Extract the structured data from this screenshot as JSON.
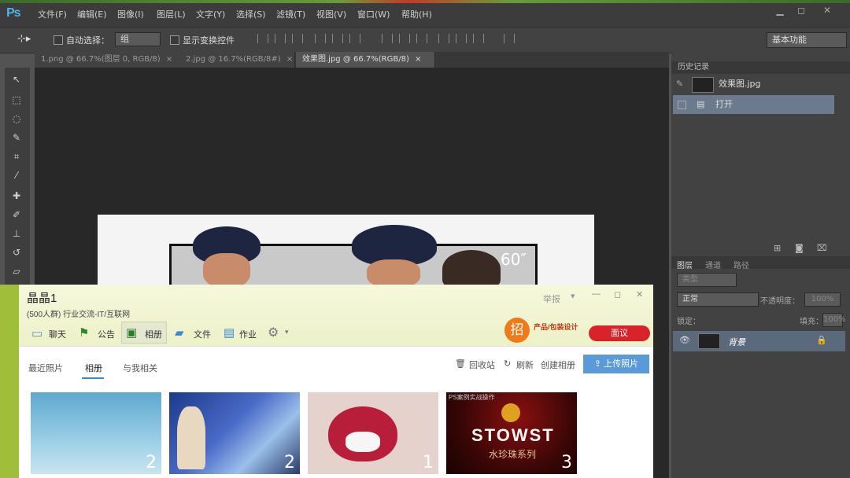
{
  "ps": {
    "logo": "Ps",
    "menu": [
      "文件(F)",
      "编辑(E)",
      "图像(I)",
      "图层(L)",
      "文字(Y)",
      "选择(S)",
      "滤镜(T)",
      "视图(V)",
      "窗口(W)",
      "帮助(H)"
    ],
    "window_controls": [
      "▁",
      "◻",
      "✕"
    ],
    "options": {
      "auto_select_label": "自动选择：",
      "auto_select_value": "组",
      "show_transform_label": "显示变换控件",
      "workspace": "基本功能"
    },
    "doc_tabs": [
      {
        "label": "1.png @ 66.7%(图层 0, RGB/8)"
      },
      {
        "label": "2.jpg @ 16.7%(RGB/8#)"
      },
      {
        "label": "效果图.jpg @ 66.7%(RGB/8)"
      }
    ],
    "tab_close": "×",
    "canvas_text": "60″",
    "history": {
      "title": "历史记录",
      "snapshot": "效果图.jpg",
      "step": "打开"
    },
    "layers": {
      "tabs": [
        "图层",
        "通道",
        "路径"
      ],
      "filter": "类型",
      "blend": "正常",
      "opacity_label": "不透明度：",
      "opacity_value": "100%",
      "lock_label": "锁定：",
      "fill_label": "填充：",
      "fill_value": "100%",
      "layer_name": "背景"
    }
  },
  "qq": {
    "title": "晶晶1",
    "subtitle": "(500人群) 行业交流-IT/互联网",
    "report": "举报",
    "nav": [
      "聊天",
      "公告",
      "相册",
      "文件",
      "作业"
    ],
    "ad_badge": "招",
    "ad_text": "产品/包装设计",
    "ad_button": "面议",
    "tabs": [
      "最近照片",
      "相册",
      "与我相关"
    ],
    "actions": [
      "回收站",
      "刷新",
      "创建相册"
    ],
    "upload": "上传照片",
    "albums": [
      {
        "count": "2"
      },
      {
        "count": "2"
      },
      {
        "count": "1"
      },
      {
        "count": "3",
        "caption": "PS案例实战操作",
        "brand": "STOWST",
        "subtitle": "水珍珠系列"
      }
    ]
  }
}
